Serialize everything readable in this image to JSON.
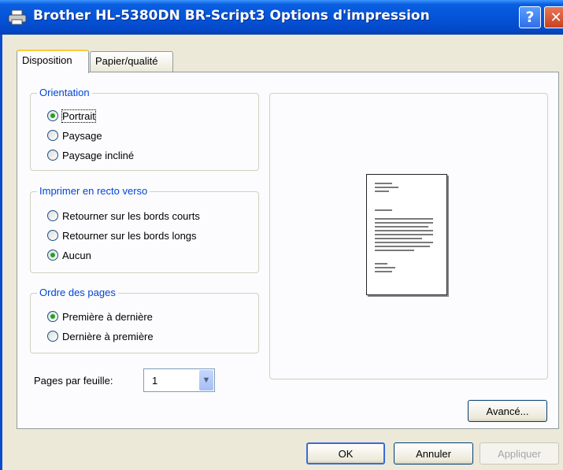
{
  "window": {
    "title": "Brother HL-5380DN BR-Script3 Options d'impression",
    "help_label": "?",
    "close_label": "✕"
  },
  "tabs": [
    {
      "label": "Disposition",
      "active": true
    },
    {
      "label": "Papier/qualité",
      "active": false
    }
  ],
  "orientation": {
    "legend": "Orientation",
    "options": [
      {
        "label": "Portrait",
        "checked": true
      },
      {
        "label": "Paysage",
        "checked": false
      },
      {
        "label": "Paysage incliné",
        "checked": false
      }
    ]
  },
  "duplex": {
    "legend": "Imprimer en recto verso",
    "options": [
      {
        "label": "Retourner sur les bords courts",
        "checked": false
      },
      {
        "label": "Retourner sur les bords longs",
        "checked": false
      },
      {
        "label": "Aucun",
        "checked": true
      }
    ]
  },
  "page_order": {
    "legend": "Ordre des pages",
    "options": [
      {
        "label": "Première à dernière",
        "checked": true
      },
      {
        "label": "Dernière à première",
        "checked": false
      }
    ]
  },
  "pages_per_sheet": {
    "label": "Pages par feuille:",
    "value": "1"
  },
  "buttons": {
    "advanced": "Avancé...",
    "ok": "OK",
    "cancel": "Annuler",
    "apply": "Appliquer"
  },
  "icons": {
    "title": "printer-icon",
    "dropdown": "chevron-down-icon",
    "preview": "document-preview-icon"
  }
}
